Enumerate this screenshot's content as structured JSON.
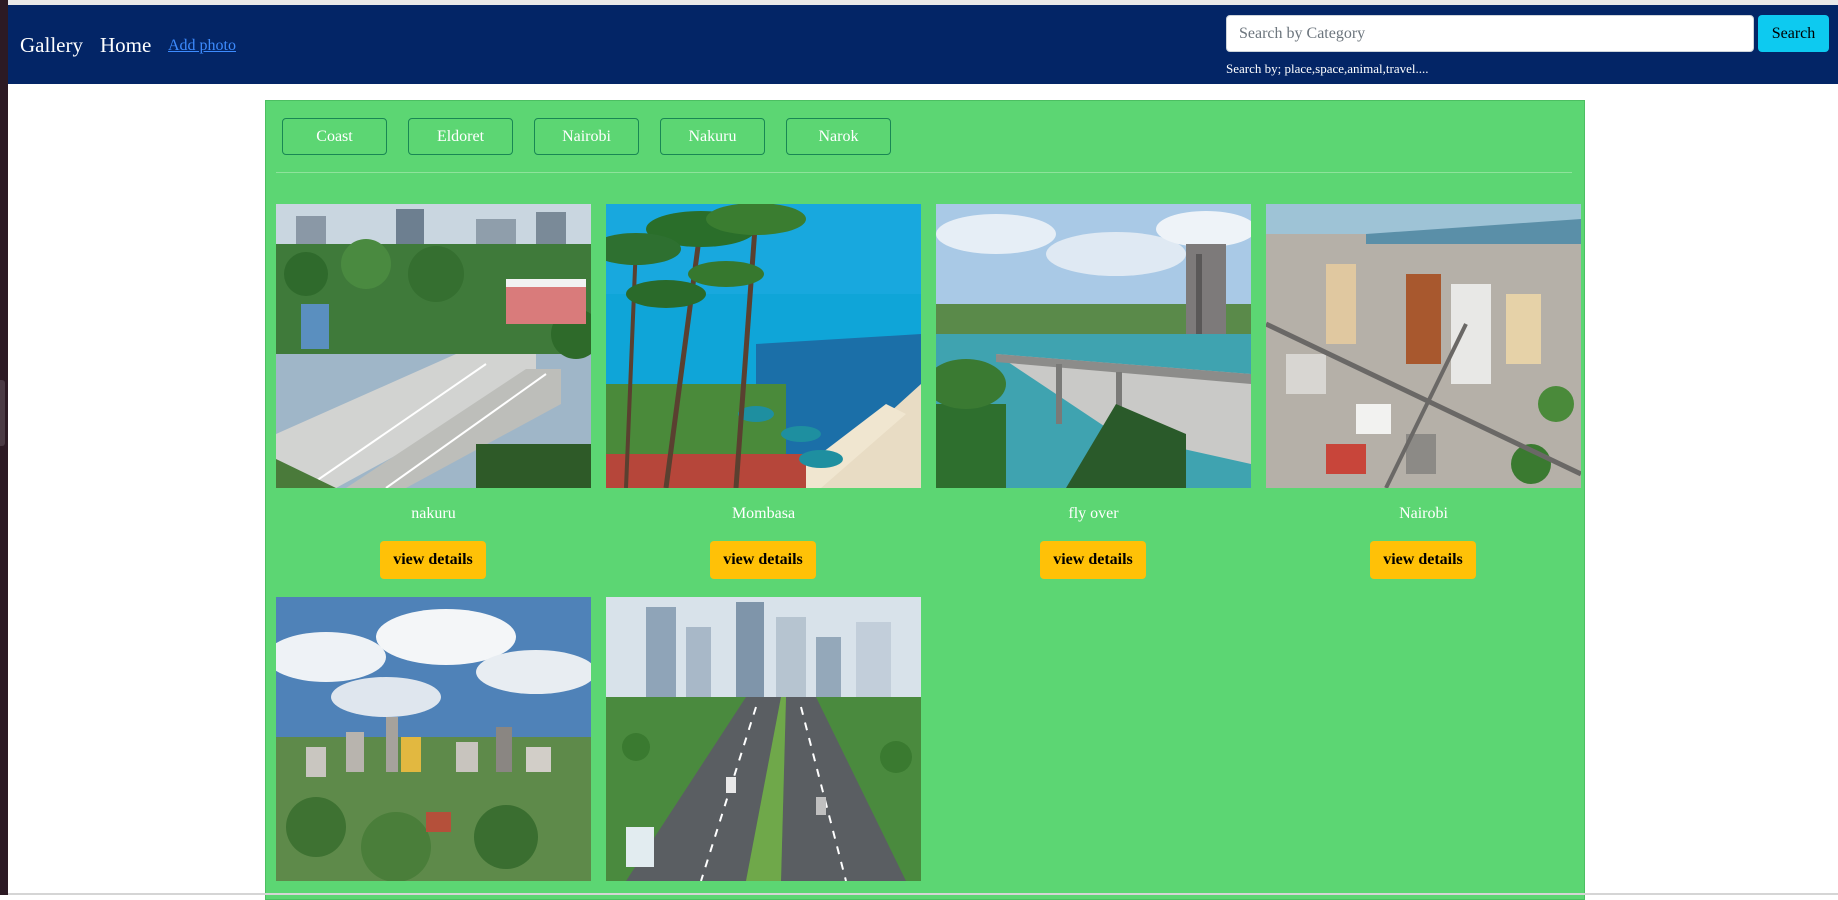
{
  "navbar": {
    "brand": "Gallery",
    "home": "Home",
    "add_photo": "Add photo",
    "search_placeholder": "Search by Category",
    "search_button": "Search",
    "search_hint": "Search by; place,space,animal,travel...."
  },
  "categories": [
    "Coast",
    "Eldoret",
    "Nairobi",
    "Nakuru",
    "Narok"
  ],
  "cards": [
    {
      "title": "nakuru",
      "button": "view details",
      "image": "highway-interchange-city"
    },
    {
      "title": "Mombasa",
      "button": "view details",
      "image": "beach-with-palms"
    },
    {
      "title": "fly over",
      "button": "view details",
      "image": "bridge-over-water"
    },
    {
      "title": "Nairobi",
      "button": "view details",
      "image": "aerial-city-view"
    },
    {
      "image": "city-skyline-clouds"
    },
    {
      "image": "expressway-skyscrapers"
    }
  ],
  "colors": {
    "navbar": "#032566",
    "container": "#5cd673",
    "search_button": "#0dcaf0",
    "view_button": "#ffc107"
  }
}
